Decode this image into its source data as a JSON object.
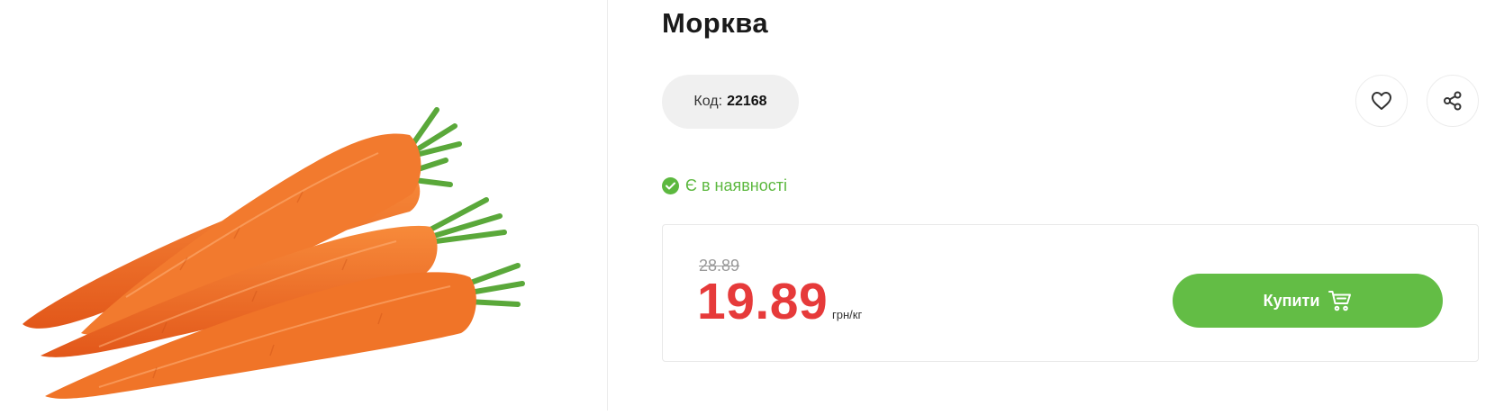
{
  "product": {
    "title": "Морква",
    "code_label": "Код:",
    "code_value": "22168",
    "stock_status": "Є в наявності",
    "old_price": "28.89",
    "price": "19.89",
    "unit": "грн/кг",
    "buy_label": "Купити"
  },
  "icons": {
    "favorite": "heart-icon",
    "share": "share-icon",
    "stock": "check-circle-icon",
    "cart": "cart-icon"
  },
  "colors": {
    "accent_green": "#63bd45",
    "price_red": "#e63a3a",
    "stock_green": "#5cb83f"
  }
}
